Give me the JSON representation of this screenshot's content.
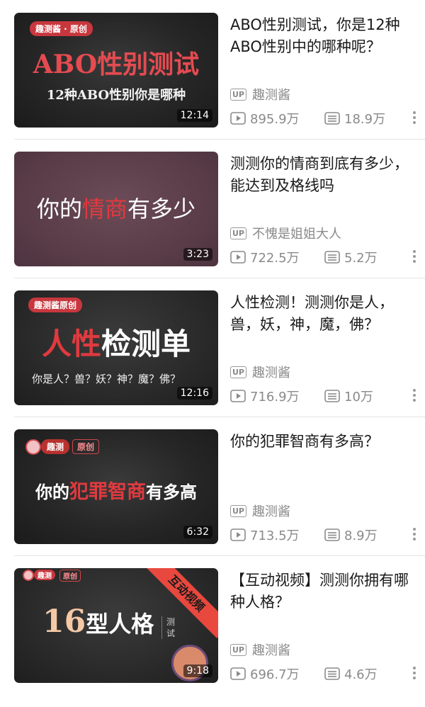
{
  "videos": [
    {
      "title": "ABO性别测试，你是12种ABO性别中的哪种呢？",
      "uploader": "趣测酱",
      "up_tag": "UP",
      "views": "895.9万",
      "comments": "18.9万",
      "duration": "12:14",
      "thumb": {
        "badge": "趣测酱 · 原创",
        "line1": "ABO性别测试",
        "line2": "12种ABO性别你是哪种"
      }
    },
    {
      "title": "测测你的情商到底有多少，能达到及格线吗",
      "uploader": "不愧是姐姐大人",
      "up_tag": "UP",
      "views": "722.5万",
      "comments": "5.2万",
      "duration": "3:23",
      "thumb": {
        "pre": "你的",
        "hl": "情商",
        "post": "有多少"
      }
    },
    {
      "title": "人性检测！测测你是人，兽，妖，神，魔，佛？",
      "uploader": "趣测酱",
      "up_tag": "UP",
      "views": "716.9万",
      "comments": "10万",
      "duration": "12:16",
      "thumb": {
        "badge": "趣测酱原创",
        "hl": "人性",
        "post": "检测单",
        "sub": "你是人？兽？妖？神？魔？佛？"
      }
    },
    {
      "title": "你的犯罪智商有多高？",
      "uploader": "趣测酱",
      "up_tag": "UP",
      "views": "713.5万",
      "comments": "8.9万",
      "duration": "6:32",
      "thumb": {
        "badge": "趣测",
        "badge2": "原创",
        "pre": "你的",
        "hl": "犯罪智商",
        "post": "有多高"
      }
    },
    {
      "title": "【互动视频】测测你拥有哪种人格？",
      "uploader": "趣测酱",
      "up_tag": "UP",
      "views": "696.7万",
      "comments": "4.6万",
      "duration": "9:18",
      "thumb": {
        "badge": "趣测",
        "badge2": "原创",
        "num": "16",
        "text": "型人格",
        "side": "测试",
        "ribbon": "互动视频"
      }
    }
  ],
  "colors": {
    "accent": "#e03a3f",
    "meta": "#8a8a8a",
    "title": "#1a1a1a"
  },
  "icons": {
    "views": "play-icon",
    "comments": "comment-icon",
    "more": "more-vertical-icon",
    "up": "up-badge-icon"
  }
}
